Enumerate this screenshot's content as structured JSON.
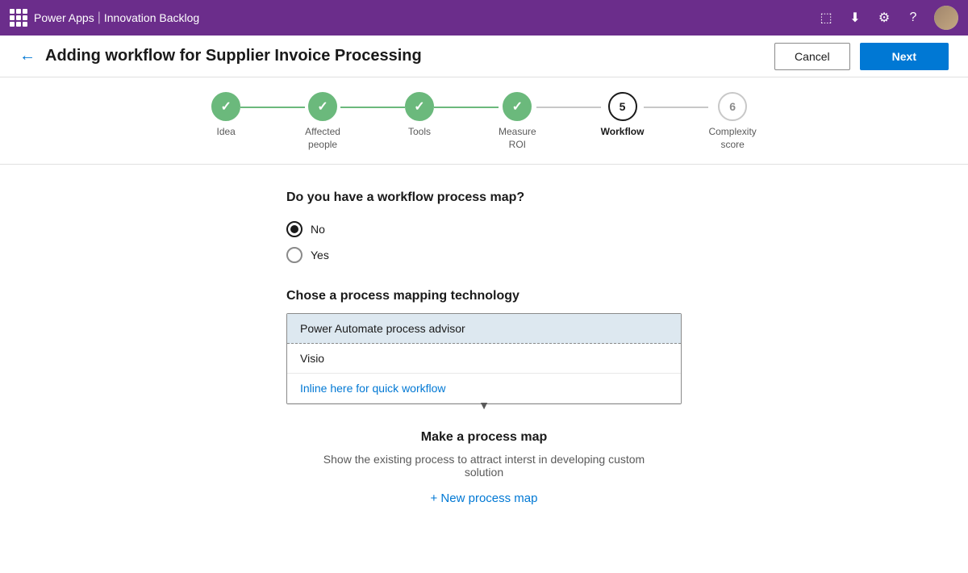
{
  "topbar": {
    "app_name": "Power Apps",
    "separator": "|",
    "project_name": "Innovation Backlog"
  },
  "header": {
    "title": "Adding workflow for Supplier Invoice Processing",
    "cancel_label": "Cancel",
    "next_label": "Next"
  },
  "stepper": {
    "steps": [
      {
        "id": "idea",
        "label": "Idea",
        "state": "completed",
        "number": "1"
      },
      {
        "id": "affected_people",
        "label": "Affected\npeople",
        "state": "completed",
        "number": "2"
      },
      {
        "id": "tools",
        "label": "Tools",
        "state": "completed",
        "number": "3"
      },
      {
        "id": "measure_roi",
        "label": "Measure\nROI",
        "state": "completed",
        "number": "4"
      },
      {
        "id": "workflow",
        "label": "Workflow",
        "state": "active",
        "number": "5"
      },
      {
        "id": "complexity_score",
        "label": "Complexity\nscore",
        "state": "inactive",
        "number": "6"
      }
    ]
  },
  "content": {
    "question": "Do you have a workflow process map?",
    "radio_options": [
      {
        "label": "No",
        "checked": true
      },
      {
        "label": "Yes",
        "checked": false
      }
    ],
    "section_title": "Chose a process mapping technology",
    "dropdown": {
      "selected": "Power Automate process advisor",
      "options": [
        {
          "label": "Visio",
          "highlight": false
        },
        {
          "label": "Inline here for quick workflow",
          "highlight": true
        }
      ]
    },
    "process_map_title": "Make a process map",
    "process_map_desc": "Show the existing process to attract interst in developing custom solution",
    "new_process_link": "+ New process map"
  }
}
